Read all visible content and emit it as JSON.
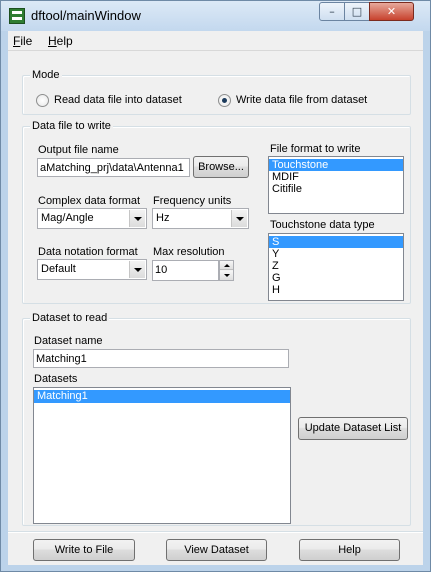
{
  "window": {
    "title": "dftool/mainWindow"
  },
  "menubar": {
    "items": [
      "File",
      "Help"
    ]
  },
  "mode": {
    "legend": "Mode",
    "read_label": "Read data file into dataset",
    "write_label": "Write data file from dataset",
    "selected": "write"
  },
  "data_file": {
    "legend": "Data file to write",
    "output_file_label": "Output file name",
    "output_file_value": "aMatching_prj\\data\\Antenna1",
    "browse_label": "Browse...",
    "complex_format_label": "Complex data format",
    "complex_format_value": "Mag/Angle",
    "frequency_units_label": "Frequency units",
    "frequency_units_value": "Hz",
    "notation_label": "Data notation format",
    "notation_value": "Default",
    "max_resolution_label": "Max resolution",
    "max_resolution_value": "10",
    "file_format_label": "File format to write",
    "file_formats": [
      "Touchstone",
      "MDIF",
      "Citifile"
    ],
    "file_format_selected": "Touchstone",
    "touchstone_type_label": "Touchstone data type",
    "touchstone_types": [
      "S",
      "Y",
      "Z",
      "G",
      "H"
    ],
    "touchstone_type_selected": "S"
  },
  "dataset": {
    "legend": "Dataset to read",
    "name_label": "Dataset name",
    "name_value": "Matching1",
    "datasets_label": "Datasets",
    "datasets": [
      "Matching1"
    ],
    "selected": "Matching1",
    "update_label": "Update Dataset List"
  },
  "footer": {
    "write_label": "Write to File",
    "view_label": "View Dataset",
    "help_label": "Help"
  },
  "icons": {
    "app": "app-icon",
    "minimize": "minimize-icon",
    "maximize": "maximize-icon",
    "close": "close-icon"
  }
}
